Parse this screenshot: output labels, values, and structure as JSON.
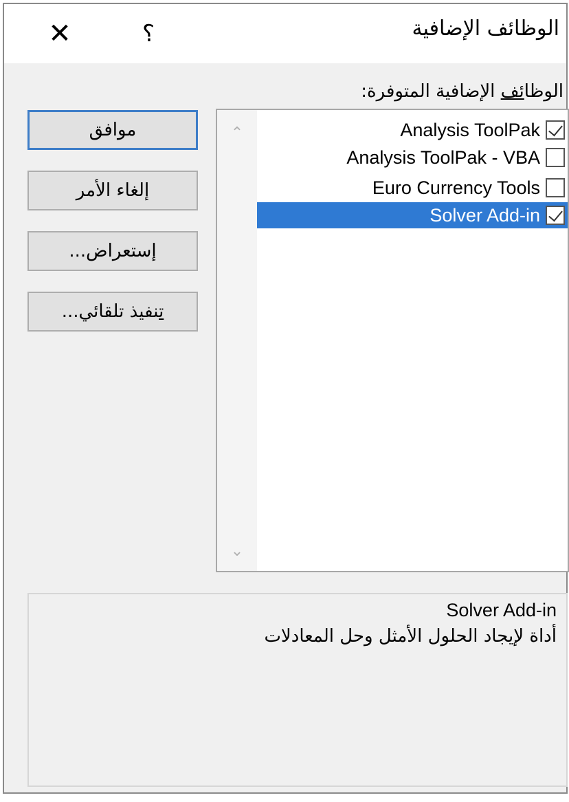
{
  "dialog": {
    "title": "الوظائف الإضافية",
    "help_icon": "question-mark-icon",
    "help_glyph": "؟",
    "close_icon": "close-icon",
    "close_glyph": "✕"
  },
  "addins": {
    "label_prefix": "الوظا",
    "label_underlined": "ئف",
    "label_suffix": " الإضافية المتوفرة:",
    "items": [
      {
        "label": "Analysis ToolPak",
        "checked": true,
        "selected": false
      },
      {
        "label": "Analysis ToolPak - VBA",
        "checked": false,
        "selected": false
      },
      {
        "label": "Euro Currency Tools",
        "checked": false,
        "selected": false
      },
      {
        "label": "Solver Add-in",
        "checked": true,
        "selected": true
      }
    ],
    "scroll_up_glyph": "⌃",
    "scroll_down_glyph": "⌄"
  },
  "buttons": {
    "ok": "موافق",
    "cancel": "إلغاء الأمر",
    "browse_underlined": "إ",
    "browse_rest": "ستعراض...",
    "automation_underlined": "ت",
    "automation_rest": "نفيذ تلقائي..."
  },
  "description": {
    "title": "Solver Add-in",
    "text": "أداة لإيجاد الحلول الأمثل وحل المعادلات"
  },
  "colors": {
    "selection": "#2f7ad3",
    "default_button_border": "#3d7dc8",
    "dialog_bg": "#f0f0f0"
  }
}
